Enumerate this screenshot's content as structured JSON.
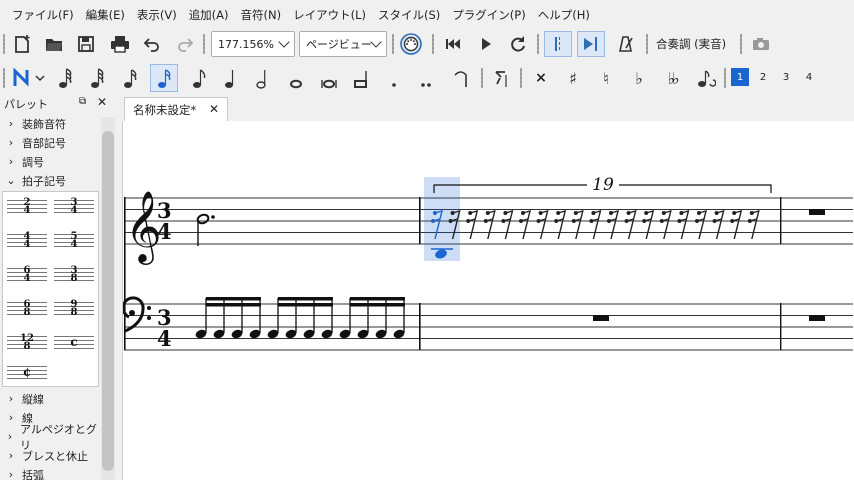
{
  "menubar": {
    "items": [
      "ファイル(F)",
      "編集(E)",
      "表示(V)",
      "追加(A)",
      "音符(N)",
      "レイアウト(L)",
      "スタイル(S)",
      "プラグイン(P)",
      "ヘルプ(H)"
    ]
  },
  "toolbar": {
    "zoom_value": "177.156%",
    "view_mode": "ページビュー",
    "concert_pitch": "合奏調 (実音)",
    "icons": [
      "new-file-icon",
      "open-icon",
      "save-icon",
      "print-icon",
      "undo-icon",
      "redo-icon",
      "midi-input-icon",
      "rewind-icon",
      "play-icon",
      "loop-icon",
      "loop-in-icon",
      "loop-out-icon",
      "metronome-icon",
      "screenshot-icon"
    ]
  },
  "note_toolbar": {
    "icons": [
      "note-input-icon",
      "64th-note-icon",
      "32nd-note-icon",
      "16th-note-icon",
      "8th-note-icon",
      "quarter-note-icon",
      "half-note-icon",
      "whole-note-icon",
      "double-whole-note-icon",
      "longa-icon",
      "dot-icon",
      "double-dot-icon",
      "tie-icon",
      "rest-icon",
      "double-sharp-icon",
      "sharp-icon",
      "natural-icon",
      "flat-icon",
      "double-flat-icon",
      "flip-icon"
    ],
    "voices": [
      "1",
      "2",
      "3",
      "4"
    ],
    "active_voice": "1"
  },
  "palette": {
    "title": "パレット",
    "categories_top": [
      "装飾音符",
      "音部記号",
      "調号",
      "拍子記号"
    ],
    "categories_bottom": [
      "縦線",
      "線",
      "アルペジオとグリ",
      "ブレスと休止",
      "括弧"
    ],
    "time_signatures": [
      {
        "top": "2",
        "bottom": "4"
      },
      {
        "top": "3",
        "bottom": "4"
      },
      {
        "top": "4",
        "bottom": "4"
      },
      {
        "top": "5",
        "bottom": "4"
      },
      {
        "top": "6",
        "bottom": "4"
      },
      {
        "top": "3",
        "bottom": "8"
      },
      {
        "top": "6",
        "bottom": "8"
      },
      {
        "top": "9",
        "bottom": "8"
      },
      {
        "top": "12",
        "bottom": "8"
      },
      {
        "symbol": "c"
      },
      {
        "symbol": "¢"
      }
    ]
  },
  "score": {
    "tab_title": "名称未設定*",
    "tuplet_number": "19",
    "time_sig_top": "3",
    "time_sig_bottom": "4",
    "selection_color": "#1a65d0"
  }
}
